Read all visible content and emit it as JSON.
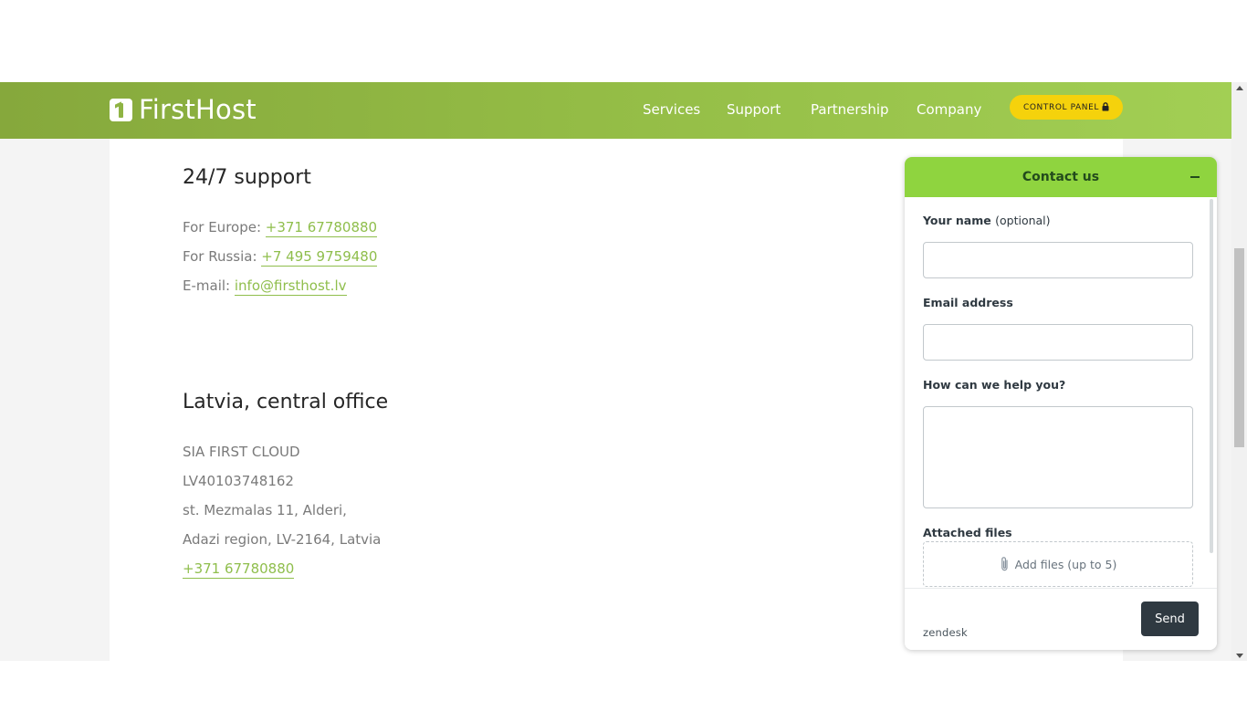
{
  "header": {
    "logo_text": "FirstHost",
    "nav": [
      "Services",
      "Support",
      "Partnership",
      "Company"
    ],
    "control_panel_label": "CONTROL PANEL"
  },
  "support": {
    "title": "24/7 support",
    "europe_label": "For Europe: ",
    "europe_phone": "+371 67780880",
    "russia_label": "For Russia: ",
    "russia_phone": "+7 495 9759480",
    "email_label": "E-mail: ",
    "email": "info@firsthost.lv"
  },
  "office": {
    "title": "Latvia, central office",
    "company": "SIA FIRST CLOUD",
    "reg_no": "LV40103748162",
    "street": "st. Mezmalas 11, Alderi,",
    "region": "Adazi region, LV-2164, Latvia",
    "phone": "+371 67780880"
  },
  "widget": {
    "title": "Contact us",
    "name_label": "Your name",
    "name_optional": "(optional)",
    "name_value": "",
    "email_label": "Email address",
    "email_value": "",
    "help_label": "How can we help you?",
    "help_value": "",
    "files_label": "Attached files",
    "files_button": "Add files (up to 5)",
    "brand": "zendesk",
    "send_label": "Send"
  },
  "colors": {
    "header_green": "#93bb45",
    "link_green": "#8fbe4c",
    "button_yellow": "#f5d20c",
    "widget_header": "#8fd43f",
    "send_button": "#2f3941"
  }
}
